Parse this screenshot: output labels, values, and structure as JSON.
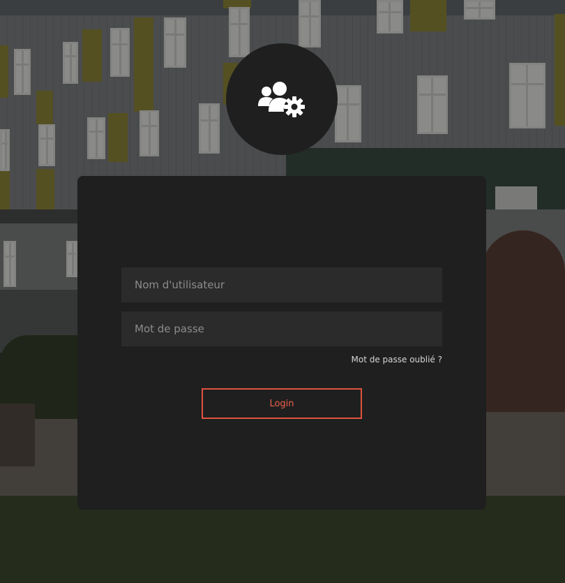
{
  "login": {
    "username_placeholder": "Nom d'utilisateur",
    "password_placeholder": "Mot de passe",
    "forgot_password_label": "Mot de passe oublié ?",
    "login_button_label": "Login",
    "avatar_icon": "users-gear-icon"
  },
  "colors": {
    "card_background": "#1f1f1f",
    "input_background": "#2b2b2b",
    "accent": "#e0533f"
  }
}
